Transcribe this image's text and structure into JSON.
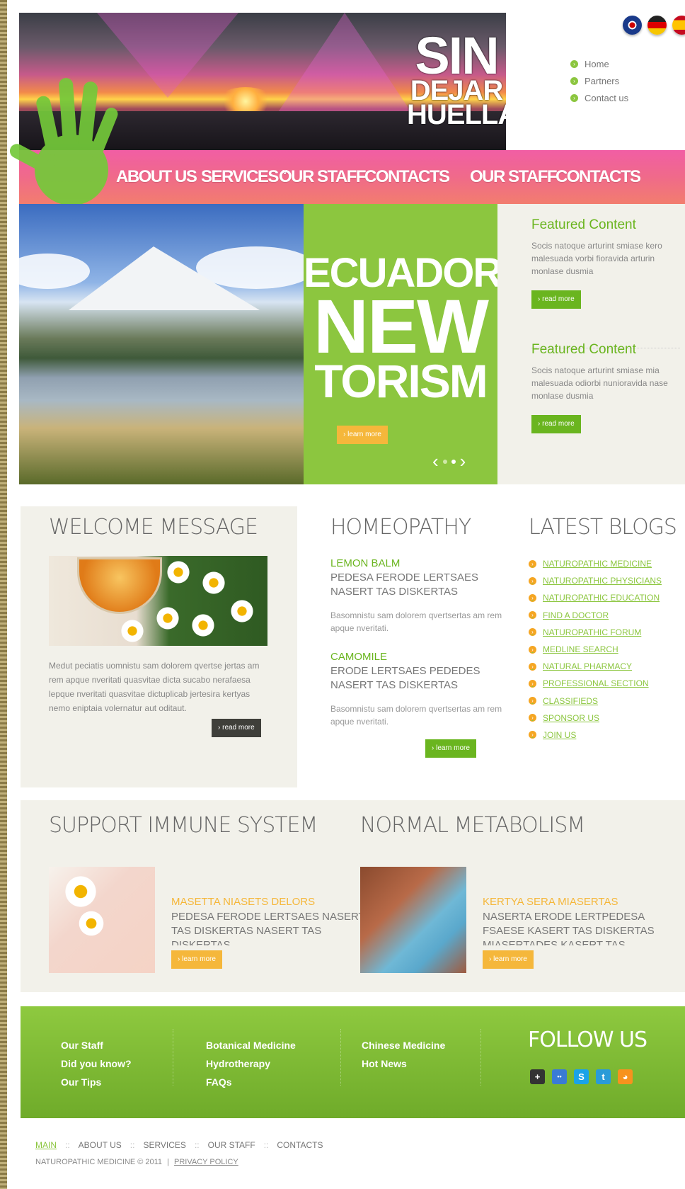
{
  "logo": {
    "line1": "SIN",
    "line2": "DEJAR",
    "line3": "HUELLA"
  },
  "languages": [
    "english-flag",
    "german-flag",
    "spanish-flag"
  ],
  "top_nav": [
    "Home",
    "Partners",
    "Contact us"
  ],
  "main_menu": [
    "ABOUT US",
    "SERVICES",
    "OUR STAFF",
    "CONTACTS",
    "OUR STAFF",
    "CONTACTS"
  ],
  "slider": {
    "line1": "ECUADOR",
    "line2": "NEW",
    "line3": "TORISM",
    "button": "› learn more"
  },
  "featured": [
    {
      "title": "Featured Content",
      "text": "Socis natoque arturint smiase kero malesuada vorbi fioravida arturin monlase dusmia",
      "button": "› read more"
    },
    {
      "title": "Featured Content",
      "text": "Socis natoque arturint smiase mia malesuada odiorbi nunioravida nase monlase dusmia",
      "button": "› read more"
    }
  ],
  "welcome": {
    "title": "WELCOME MESSAGE",
    "text": "Medut peciatis uomnistu sam dolorem qvertse jertas am rem apque nveritati quasvitae dicta sucabo nerafaesa lepque nveritati quasvitae dictuplicab jertesira kertyas nemo eniptaia volernatur aut oditaut.",
    "button": "› read more"
  },
  "homeopathy": {
    "title": "HOMEOPATHY",
    "items": [
      {
        "title": "LEMON BALM",
        "subtitle": "PEDESA FERODE LERTSAES NASERT TAS DISKERTAS",
        "text": "Basomnistu sam dolorem qvertsertas am rem apque nveritati."
      },
      {
        "title": "CAMOMILE",
        "subtitle": "ERODE LERTSAES PEDEDES NASERT TAS DISKERTAS",
        "text": "Basomnistu sam dolorem qvertsertas am rem apque nveritati."
      }
    ],
    "button": "› learn more"
  },
  "blogs": {
    "title": "LATEST BLOGS",
    "items": [
      "NATUROPATHIC MEDICINE",
      "NATUROPATHIC PHYSICIANS",
      "NATUROPATHIC EDUCATION",
      "FIND A DOCTOR",
      "NATUROPATHIC FORUM",
      "MEDLINE SEARCH",
      "NATURAL PHARMACY",
      "PROFESSIONAL SECTION",
      "CLASSIFIEDS",
      "SPONSOR US",
      "JOIN US"
    ]
  },
  "support": {
    "title": "SUPPORT IMMUNE SYSTEM",
    "item_title": "MASETTA NIASETS DELORS",
    "item_text": "PEDESA FERODE LERTSAES NASERT TAS DISKERTAS NASERT TAS DISKERTAS",
    "button": "› learn more"
  },
  "metabolism": {
    "title": "NORMAL METABOLISM",
    "item_title": "KERTYA SERA MIASERTAS",
    "item_text": "NASERTA ERODE LERTPEDESA FSAESE KASERT TAS DISKERTAS MIASERTADES KASERT TAS DISKERTAS MIASERTADES",
    "button": "› learn more"
  },
  "footer": {
    "col1": [
      "Our Staff",
      "Did you know?",
      "Our Tips"
    ],
    "col2": [
      "Botanical Medicine",
      "Hydrotherapy",
      "FAQs"
    ],
    "col3": [
      "Chinese Medicine",
      "Hot News"
    ],
    "follow_title": "FOLLOW US",
    "social": [
      {
        "icon": "google-plus-icon",
        "glyph": "+",
        "color": "#333333"
      },
      {
        "icon": "flickr-icon",
        "glyph": "••",
        "color": "#3a7bd5"
      },
      {
        "icon": "skype-icon",
        "glyph": "S",
        "color": "#1aa3e8"
      },
      {
        "icon": "twitter-icon",
        "glyph": "t",
        "color": "#2a9bd8"
      },
      {
        "icon": "rss-icon",
        "glyph": "◕",
        "color": "#f7921e"
      }
    ]
  },
  "bottom_nav": [
    "MAIN",
    "ABOUT US",
    "SERVICES",
    "OUR STAFF",
    "CONTACTS"
  ],
  "bottom_sep": "::",
  "copyright": "NATUROPATHIC MEDICINE © 2011",
  "copyright_sep": "|",
  "privacy": "PRIVACY POLICY",
  "colors": {
    "green": "#8cc63f",
    "pink": "#f15ea4",
    "orange": "#f5b73b",
    "panel": "#f2f1ea"
  }
}
